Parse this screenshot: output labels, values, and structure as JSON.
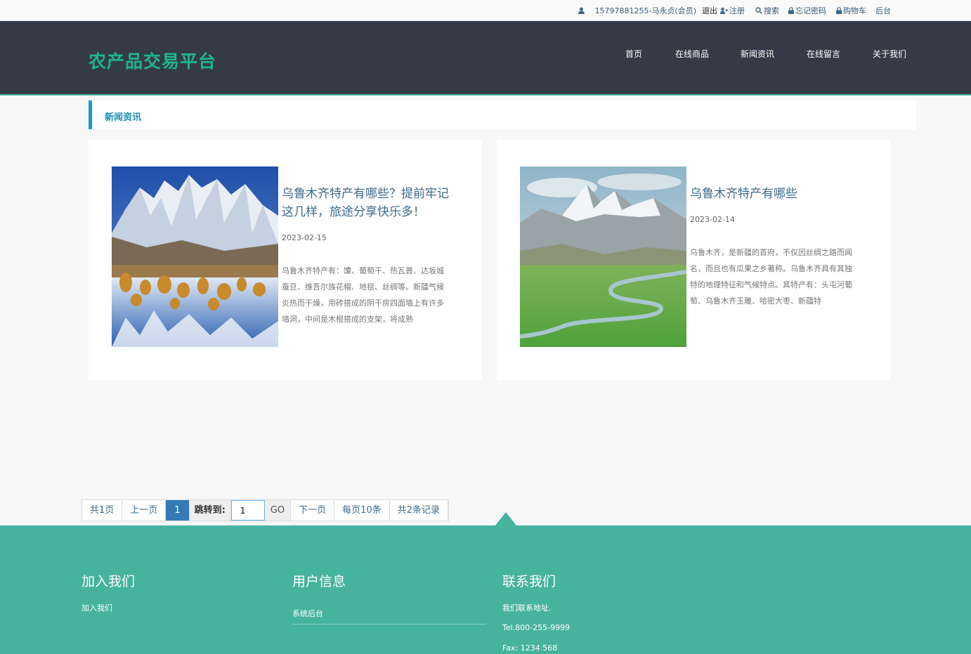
{
  "topbar": {
    "user": "15797881255-马永贞(会员)",
    "logout": "退出",
    "register": "注册",
    "search": "搜索",
    "forgot": "忘记密码",
    "cart": "购物车",
    "admin": "后台"
  },
  "header": {
    "logo": "农产品交易平台",
    "nav": [
      "首页",
      "在线商品",
      "新闻资讯",
      "在线留言",
      "关于我们"
    ]
  },
  "section": {
    "title": "新闻资讯"
  },
  "news": [
    {
      "title": "乌鲁木齐特产有哪些？提前牢记这几样，旅途分享快乐多！",
      "date": "2023-02-15",
      "excerpt": "乌鲁木齐特产有：馕、葡萄干、热瓦普、达坂城蚕豆、维吾尔族花帽、地毯、丝绸等。新疆气候炎热而干燥，用砖搭成的阴干房四面墙上有许多墙洞，中间是木棍搭成的支架，将成熟"
    },
    {
      "title": "乌鲁木齐特产有哪些",
      "date": "2023-02-14",
      "excerpt": "乌鲁木齐，是新疆的首府，不仅因丝绸之路而闻名，而且也有瓜果之乡著称。乌鲁木齐具有其独特的地理特征和气候特点。其特产有：头屯河葡萄、乌鲁木齐玉雕、哈密大枣、新疆特"
    }
  ],
  "pager": {
    "total_pages": "共1页",
    "prev": "上一页",
    "current": "1",
    "jump_label": "跳转到:",
    "jump_value": "1",
    "go": "GO",
    "next": "下一页",
    "per_page": "每页10条",
    "total_records": "共2条记录"
  },
  "footer": {
    "join": {
      "heading": "加入我们",
      "link": "加入我们"
    },
    "user": {
      "heading": "用户信息",
      "link": "系统后台"
    },
    "contact": {
      "heading": "联系我们",
      "address": "我们联系地址.",
      "tel": "Tel.800-255-9999",
      "fax": "Fax: 1234 568"
    }
  },
  "colors": {
    "brand": "#1fb48c",
    "header_bg": "#343b47",
    "footer_bg": "#46b39f",
    "section_accent": "#1a9bd0",
    "pager_active": "#337ab7"
  },
  "icons": [
    "user-icon",
    "user-plus-icon",
    "search-icon",
    "lock-icon"
  ]
}
